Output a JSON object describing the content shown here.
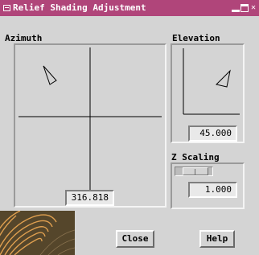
{
  "window": {
    "title": "Relief Shading Adjustment"
  },
  "azimuth": {
    "label": "Azimuth",
    "value": "316.818"
  },
  "elevation": {
    "label": "Elevation",
    "value": "45.000"
  },
  "z_scaling": {
    "label": "Z Scaling",
    "value": "1.000"
  },
  "buttons": {
    "close": "Close",
    "help": "Help"
  },
  "colors": {
    "title_bar": "#b0457a",
    "panel": "#d4d4d4"
  }
}
